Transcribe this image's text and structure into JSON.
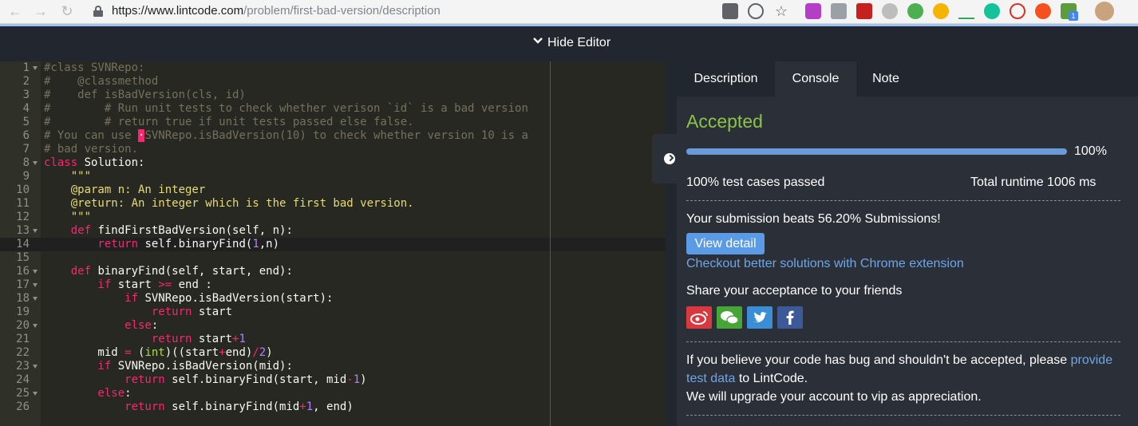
{
  "browser": {
    "url_host": "https://www.lintcode.com",
    "url_path": "/problem/first-bad-version/description",
    "extension_badge": "1"
  },
  "toolbar": {
    "hide_editor_label": "Hide Editor"
  },
  "editor": {
    "lines": [
      {
        "n": "1",
        "fold": true,
        "parts": [
          [
            "c-com",
            "#class SVNRepo:"
          ]
        ]
      },
      {
        "n": "2",
        "fold": false,
        "parts": [
          [
            "c-com",
            "#    @classmethod"
          ]
        ]
      },
      {
        "n": "3",
        "fold": false,
        "parts": [
          [
            "c-com",
            "#    def isBadVersion(cls, id)"
          ]
        ]
      },
      {
        "n": "4",
        "fold": false,
        "parts": [
          [
            "c-com",
            "#        # Run unit tests to check whether verison `id` is a bad version"
          ]
        ]
      },
      {
        "n": "5",
        "fold": false,
        "parts": [
          [
            "c-com",
            "#        # return true if unit tests passed else false."
          ]
        ]
      },
      {
        "n": "6",
        "fold": false,
        "parts": [
          [
            "c-com",
            "# You can use "
          ],
          [
            "cursor-mark",
            "·"
          ],
          [
            "c-com",
            "SVNRepo.isBadVersion(10) to check whether version 10 is a"
          ]
        ]
      },
      {
        "n": "7",
        "fold": false,
        "parts": [
          [
            "c-com",
            "# bad version."
          ]
        ]
      },
      {
        "n": "8",
        "fold": true,
        "parts": [
          [
            "c-kw",
            "class"
          ],
          [
            "c-plain",
            " Solution:"
          ]
        ]
      },
      {
        "n": "9",
        "fold": false,
        "parts": [
          [
            "c-str",
            "    \"\"\""
          ]
        ]
      },
      {
        "n": "10",
        "fold": false,
        "parts": [
          [
            "c-str",
            "    @param n: An integer"
          ]
        ]
      },
      {
        "n": "11",
        "fold": false,
        "parts": [
          [
            "c-str",
            "    @return: An integer which is the first bad version."
          ]
        ]
      },
      {
        "n": "12",
        "fold": false,
        "parts": [
          [
            "c-str",
            "    \"\"\""
          ]
        ]
      },
      {
        "n": "13",
        "fold": true,
        "parts": [
          [
            "c-kw",
            "    def"
          ],
          [
            "c-plain",
            " findFirstBadVersion(self, n):"
          ]
        ]
      },
      {
        "n": "14",
        "fold": false,
        "parts": [
          [
            "c-kw",
            "        return"
          ],
          [
            "c-plain",
            " self.binaryFind("
          ],
          [
            "c-num",
            "1"
          ],
          [
            "c-plain",
            ",n)"
          ]
        ]
      },
      {
        "n": "15",
        "fold": false,
        "parts": [
          [
            "c-plain",
            ""
          ]
        ]
      },
      {
        "n": "16",
        "fold": true,
        "parts": [
          [
            "c-kw",
            "    def"
          ],
          [
            "c-plain",
            " binaryFind(self, start, end):"
          ]
        ]
      },
      {
        "n": "17",
        "fold": true,
        "parts": [
          [
            "c-kw",
            "        if"
          ],
          [
            "c-plain",
            " start "
          ],
          [
            "c-kw",
            ">="
          ],
          [
            "c-plain",
            " end :"
          ]
        ]
      },
      {
        "n": "18",
        "fold": true,
        "parts": [
          [
            "c-kw",
            "            if"
          ],
          [
            "c-plain",
            " SVNRepo.isBadVersion(start):"
          ]
        ]
      },
      {
        "n": "19",
        "fold": false,
        "parts": [
          [
            "c-kw",
            "                return"
          ],
          [
            "c-plain",
            " start"
          ]
        ]
      },
      {
        "n": "20",
        "fold": true,
        "parts": [
          [
            "c-kw",
            "            else"
          ],
          [
            "c-plain",
            ":"
          ]
        ]
      },
      {
        "n": "21",
        "fold": false,
        "parts": [
          [
            "c-kw",
            "                return"
          ],
          [
            "c-plain",
            " start"
          ],
          [
            "c-kw",
            "+"
          ],
          [
            "c-num",
            "1"
          ]
        ]
      },
      {
        "n": "22",
        "fold": false,
        "parts": [
          [
            "c-plain",
            "        mid "
          ],
          [
            "c-kw",
            "="
          ],
          [
            "c-plain",
            " ("
          ],
          [
            "c-fn",
            "int"
          ],
          [
            "c-plain",
            ")((start"
          ],
          [
            "c-kw",
            "+"
          ],
          [
            "c-plain",
            "end)"
          ],
          [
            "c-kw",
            "/"
          ],
          [
            "c-num",
            "2"
          ],
          [
            "c-plain",
            ")"
          ]
        ]
      },
      {
        "n": "23",
        "fold": true,
        "parts": [
          [
            "c-kw",
            "        if"
          ],
          [
            "c-plain",
            " SVNRepo.isBadVersion(mid):"
          ]
        ]
      },
      {
        "n": "24",
        "fold": false,
        "parts": [
          [
            "c-kw",
            "            return"
          ],
          [
            "c-plain",
            " self.binaryFind(start, mid"
          ],
          [
            "c-kw",
            "-"
          ],
          [
            "c-num",
            "1"
          ],
          [
            "c-plain",
            ")"
          ]
        ]
      },
      {
        "n": "25",
        "fold": true,
        "parts": [
          [
            "c-kw",
            "        else"
          ],
          [
            "c-plain",
            ":"
          ]
        ]
      },
      {
        "n": "26",
        "fold": false,
        "parts": [
          [
            "c-kw",
            "            return"
          ],
          [
            "c-plain",
            " self.binaryFind(mid"
          ],
          [
            "c-kw",
            "+"
          ],
          [
            "c-num",
            "1"
          ],
          [
            "c-plain",
            ", end)"
          ]
        ]
      }
    ]
  },
  "tabs": {
    "description": "Description",
    "console": "Console",
    "note": "Note",
    "active": "Console"
  },
  "result": {
    "status": "Accepted",
    "status_color": "#8bc34a",
    "progress_fraction": 1.0,
    "progress_label": "100%",
    "tests_passed": "100% test cases passed",
    "runtime": "Total runtime 1006 ms",
    "beats": "Your submission beats 56.20% Submissions!",
    "view_detail": "View detail",
    "chrome_ext_link": "Checkout better solutions with Chrome extension",
    "share_heading": "Share your acceptance to your friends",
    "bug_text_1": "If you believe your code has bug and shouldn't be accepted, please ",
    "bug_link": "provide test data",
    "bug_text_2": " to LintCode.",
    "upgrade_text": "We will upgrade your account to vip as appreciation."
  },
  "share": [
    {
      "name": "weibo-icon",
      "color": "#d9383e"
    },
    {
      "name": "wechat-icon",
      "color": "#47a437"
    },
    {
      "name": "twitter-icon",
      "color": "#3a8ed6"
    },
    {
      "name": "facebook-icon",
      "color": "#3d5a98"
    }
  ],
  "colors": {
    "accent": "#5b9be6",
    "link": "#6ea6e8"
  }
}
